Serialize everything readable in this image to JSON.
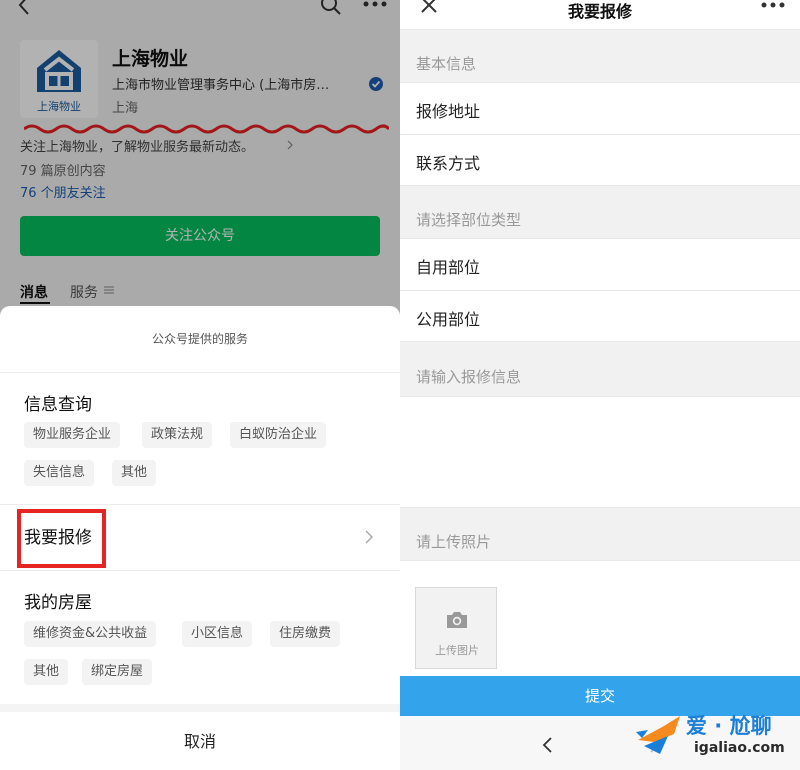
{
  "colors": {
    "wechat_green": "#07c160",
    "submit_blue": "#33a4eb",
    "highlight_red": "#e52521",
    "brand_blue": "#1c5da0",
    "link_blue": "#1e5eb1"
  },
  "left": {
    "account": {
      "logo_text": "上海物业",
      "name": "上海物业",
      "org": "上海市物业管理事务中心 (上海市房…",
      "city": "上海",
      "description": "关注上海物业，了解物业服务最新动态。",
      "articles": "79 篇原创内容",
      "friends": "76 个朋友关注",
      "follow_label": "关注公众号"
    },
    "tabs": {
      "messages": "消息",
      "services": "服务"
    },
    "sheet": {
      "title": "公众号提供的服务",
      "info_query": {
        "title": "信息查询",
        "chips": [
          "物业服务企业",
          "政策法规",
          "白蚁防治企业",
          "失信信息",
          "其他"
        ]
      },
      "repair": {
        "label": "我要报修"
      },
      "my_house": {
        "title": "我的房屋",
        "chips": [
          "维修资金&公共收益",
          "小区信息",
          "住房缴费",
          "其他",
          "绑定房屋"
        ]
      },
      "cancel_label": "取消"
    }
  },
  "right": {
    "title": "我要报修",
    "basic_info_label": "基本信息",
    "address_label": "报修地址",
    "contact_label": "联系方式",
    "part_type_label": "请选择部位类型",
    "private_part_label": "自用部位",
    "public_part_label": "公用部位",
    "repair_info_label": "请输入报修信息",
    "photo_label": "请上传照片",
    "upload_text": "上传图片",
    "submit_label": "提交"
  },
  "watermark": {
    "main": "爱 · 尬聊",
    "url": "igaliao.com"
  }
}
